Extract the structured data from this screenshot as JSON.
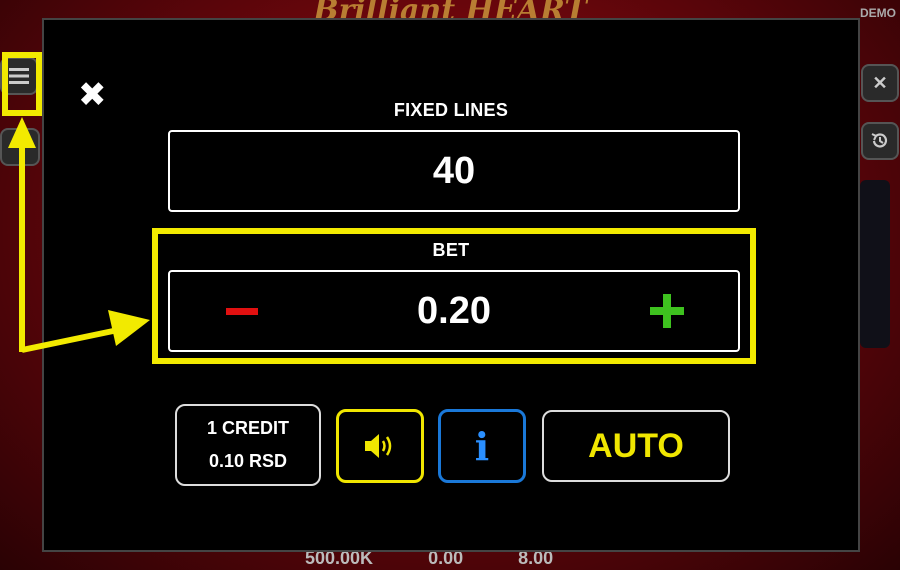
{
  "background": {
    "title": "Brilliant HEART",
    "demo_label": "DEMO",
    "stats": [
      "500.00K",
      "0.00",
      "8.00"
    ]
  },
  "settings": {
    "fixed_lines_label": "FIXED LINES",
    "fixed_lines_value": "40",
    "bet_label": "BET",
    "bet_value": "0.20",
    "credit_line1": "1 CREDIT",
    "credit_line2": "0.10 RSD",
    "auto_label": "AUTO",
    "info_glyph": "i"
  },
  "icons": {
    "close": "close-icon",
    "menu": "menu-icon",
    "sound": "speaker-icon",
    "info": "info-icon",
    "minus": "minus-icon",
    "plus": "plus-icon",
    "history": "history-icon"
  },
  "colors": {
    "highlight": "#f2ea00",
    "minus": "#e11010",
    "plus": "#3ec21f",
    "info": "#1a78d8",
    "auto_text": "#f0e600"
  }
}
